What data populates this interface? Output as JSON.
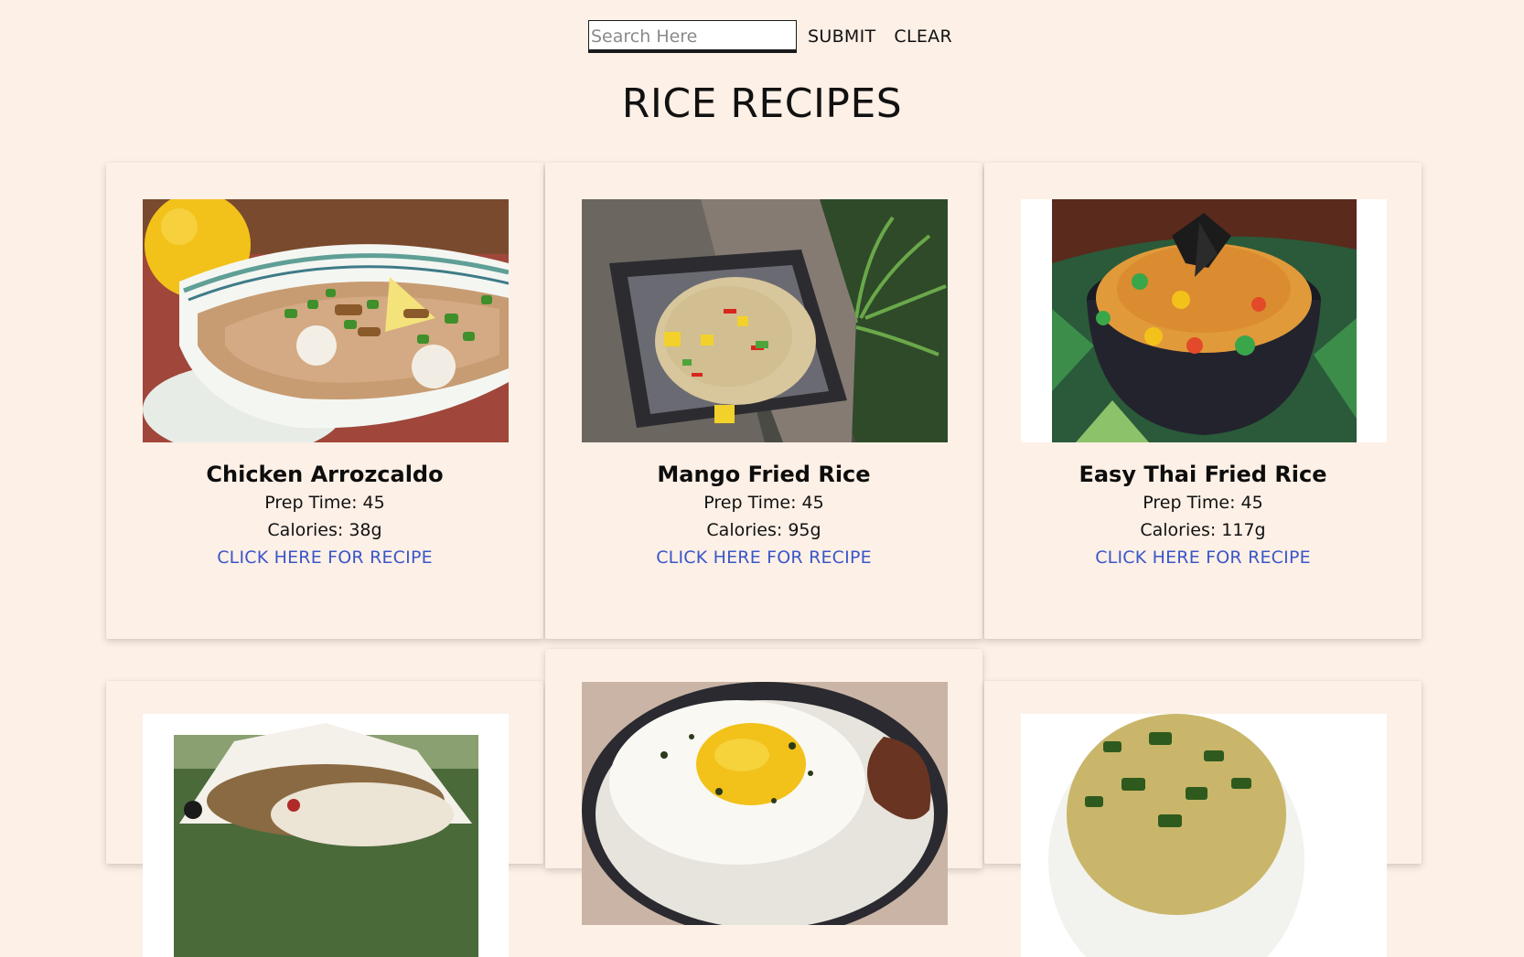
{
  "search": {
    "placeholder": "Search Here",
    "value": ""
  },
  "toolbar": {
    "submit_label": "SUBMIT",
    "clear_label": "CLEAR"
  },
  "page": {
    "title": "RICE RECIPES"
  },
  "recipes": [
    {
      "name": "Chicken Arrozcaldo",
      "prep_time": "Prep Time: 45",
      "calories": "Calories: 38g",
      "link": "CLICK HERE FOR RECIPE"
    },
    {
      "name": "Mango Fried Rice",
      "prep_time": "Prep Time: 45",
      "calories": "Calories: 95g",
      "link": "CLICK HERE FOR RECIPE"
    },
    {
      "name": "Easy Thai Fried Rice",
      "prep_time": "Prep Time: 45",
      "calories": "Calories: 117g",
      "link": "CLICK HERE FOR RECIPE"
    }
  ],
  "colors": {
    "background": "#fdf0e6",
    "link": "#3a56c9",
    "text": "#111111"
  }
}
